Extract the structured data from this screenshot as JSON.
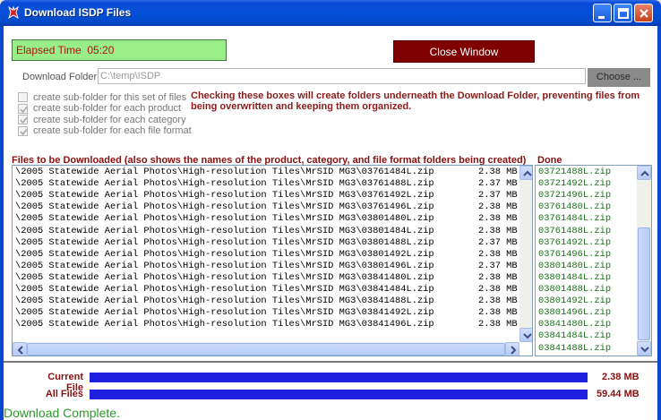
{
  "window": {
    "title": "Download ISDP Files",
    "app_icon": "isdp-icon"
  },
  "elapsed": {
    "label": "Elapsed Time",
    "value": "05:20"
  },
  "buttons": {
    "close_window": "Close Window",
    "choose": "Choose ..."
  },
  "download_folder": {
    "label": "Download Folder",
    "value": "C:\\temp\\ISDP"
  },
  "options": [
    {
      "label": "create sub-folder for this set of files",
      "checked": false
    },
    {
      "label": "create sub-folder for each product",
      "checked": true
    },
    {
      "label": "create sub-folder for each category",
      "checked": true
    },
    {
      "label": "create sub-folder for each file format",
      "checked": true
    }
  ],
  "warning": "Checking these boxes will create folders underneath the Download Folder, preventing files from being overwritten and keeping them organized.",
  "files": {
    "header": "Files to be Downloaded (also shows the names of the product, category, and file format folders being created)",
    "rows": [
      {
        "path": "\\2005 Statewide Aerial Photos\\High-resolution Tiles\\MrSID MG3\\03761484L.zip",
        "size": "2.38 MB"
      },
      {
        "path": "\\2005 Statewide Aerial Photos\\High-resolution Tiles\\MrSID MG3\\03761488L.zip",
        "size": "2.37 MB"
      },
      {
        "path": "\\2005 Statewide Aerial Photos\\High-resolution Tiles\\MrSID MG3\\03761492L.zip",
        "size": "2.37 MB"
      },
      {
        "path": "\\2005 Statewide Aerial Photos\\High-resolution Tiles\\MrSID MG3\\03761496L.zip",
        "size": "2.38 MB"
      },
      {
        "path": "\\2005 Statewide Aerial Photos\\High-resolution Tiles\\MrSID MG3\\03801480L.zip",
        "size": "2.38 MB"
      },
      {
        "path": "\\2005 Statewide Aerial Photos\\High-resolution Tiles\\MrSID MG3\\03801484L.zip",
        "size": "2.38 MB"
      },
      {
        "path": "\\2005 Statewide Aerial Photos\\High-resolution Tiles\\MrSID MG3\\03801488L.zip",
        "size": "2.37 MB"
      },
      {
        "path": "\\2005 Statewide Aerial Photos\\High-resolution Tiles\\MrSID MG3\\03801492L.zip",
        "size": "2.38 MB"
      },
      {
        "path": "\\2005 Statewide Aerial Photos\\High-resolution Tiles\\MrSID MG3\\03801496L.zip",
        "size": "2.37 MB"
      },
      {
        "path": "\\2005 Statewide Aerial Photos\\High-resolution Tiles\\MrSID MG3\\03841480L.zip",
        "size": "2.38 MB"
      },
      {
        "path": "\\2005 Statewide Aerial Photos\\High-resolution Tiles\\MrSID MG3\\03841484L.zip",
        "size": "2.38 MB"
      },
      {
        "path": "\\2005 Statewide Aerial Photos\\High-resolution Tiles\\MrSID MG3\\03841488L.zip",
        "size": "2.38 MB"
      },
      {
        "path": "\\2005 Statewide Aerial Photos\\High-resolution Tiles\\MrSID MG3\\03841492L.zip",
        "size": "2.38 MB"
      },
      {
        "path": "\\2005 Statewide Aerial Photos\\High-resolution Tiles\\MrSID MG3\\03841496L.zip",
        "size": "2.38 MB"
      }
    ]
  },
  "done": {
    "header": "Done",
    "rows": [
      "03721488L.zip",
      "03721492L.zip",
      "03721496L.zip",
      "03761480L.zip",
      "03761484L.zip",
      "03761488L.zip",
      "03761492L.zip",
      "03761496L.zip",
      "03801480L.zip",
      "03801484L.zip",
      "03801488L.zip",
      "03801492L.zip",
      "03801496L.zip",
      "03841480L.zip",
      "03841484L.zip",
      "03841488L.zip"
    ]
  },
  "progress": {
    "current": {
      "label": "Current File",
      "value": "2.38 MB",
      "fraction": 1.0
    },
    "all": {
      "label": "All Files",
      "value": "59.44 MB",
      "fraction": 1.0
    }
  },
  "status": "Download Complete.",
  "colors": {
    "accent_red": "#8a1010",
    "elapsed_bg": "#99ee88",
    "progress_fill": "#1f1fe0",
    "done_text": "#1d6f1d",
    "status_green": "#2a9a2a"
  }
}
